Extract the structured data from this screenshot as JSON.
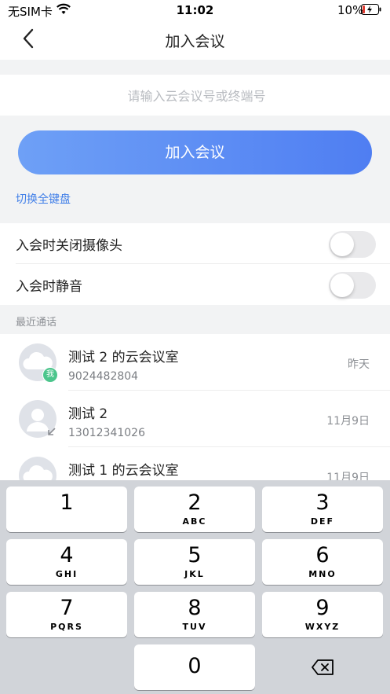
{
  "status_bar": {
    "carrier": "无SIM卡",
    "time": "11:02",
    "battery": "10%"
  },
  "nav": {
    "title": "加入会议"
  },
  "meeting_input": {
    "placeholder": "请输入云会议号或终端号",
    "value": ""
  },
  "join_button": {
    "label": "加入会议"
  },
  "switch_keyboard": {
    "label": "切换全键盘"
  },
  "settings": [
    {
      "label": "入会时关闭摄像头",
      "enabled": false
    },
    {
      "label": "入会时静音",
      "enabled": false
    }
  ],
  "recent": {
    "title": "最近通话",
    "items": [
      {
        "name": "测试 2 的云会议室",
        "number": "9024482804",
        "date": "昨天",
        "avatar": "cloud-icon",
        "badge": "我"
      },
      {
        "name": "测试 2",
        "number": "13012341026",
        "date": "11月9日",
        "avatar": "person-icon"
      },
      {
        "name": "测试 1 的云会议室",
        "number": "",
        "date": "11月9日",
        "avatar": "cloud-icon"
      }
    ]
  },
  "keypad": {
    "keys": [
      {
        "num": "1",
        "letters": ""
      },
      {
        "num": "2",
        "letters": "ABC"
      },
      {
        "num": "3",
        "letters": "DEF"
      },
      {
        "num": "4",
        "letters": "GHI"
      },
      {
        "num": "5",
        "letters": "JKL"
      },
      {
        "num": "6",
        "letters": "MNO"
      },
      {
        "num": "7",
        "letters": "PQRS"
      },
      {
        "num": "8",
        "letters": "TUV"
      },
      {
        "num": "9",
        "letters": "WXYZ"
      },
      {
        "num": "0",
        "letters": ""
      }
    ],
    "delete_icon": "backspace-icon"
  },
  "colors": {
    "accent": "#4f7ef2",
    "link": "#3f7ee8",
    "badge": "#4cc58c"
  }
}
